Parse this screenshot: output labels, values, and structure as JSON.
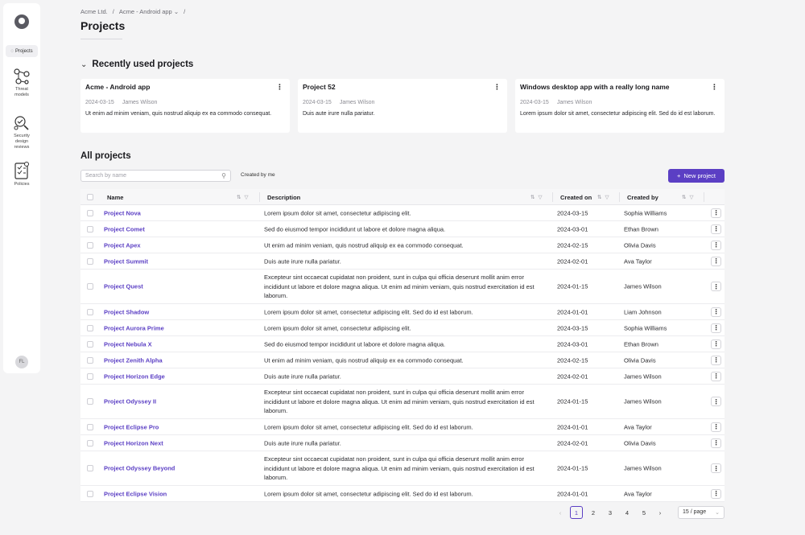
{
  "sidebar": {
    "items": [
      {
        "label": "Projects"
      },
      {
        "label_lines": [
          "Threat",
          "models"
        ]
      },
      {
        "label_lines": [
          "Security",
          "design",
          "reviews"
        ]
      },
      {
        "label_lines": [
          "Policies"
        ]
      }
    ],
    "avatar": "FL"
  },
  "breadcrumb": {
    "org": "Acme Ltd.",
    "sep1": "/",
    "project": "Acme - Android app",
    "sep2": "/"
  },
  "page_title": "Projects",
  "recent": {
    "title": "Recently used projects",
    "cards": [
      {
        "title": "Acme - Android app",
        "date": "2024-03-15",
        "user": "James Wilson",
        "desc": "Ut enim ad minim veniam, quis nostrud aliquip ex ea commodo consequat."
      },
      {
        "title": "Project 52",
        "date": "2024-03-15",
        "user": "James Wilson",
        "desc": "Duis aute irure nulla pariatur."
      },
      {
        "title": "Windows desktop app with a really long name",
        "date": "2024-03-15",
        "user": "James Wilson",
        "desc": "Lorem ipsum dolor sit amet, consectetur adipiscing elit. Sed do id est laborum."
      }
    ]
  },
  "all": {
    "title": "All projects",
    "search_placeholder": "Search by name",
    "filter_label": "Created by me",
    "new_button": "New project",
    "columns": {
      "name": "Name",
      "description": "Description",
      "created_on": "Created on",
      "created_by": "Created by"
    },
    "rows": [
      {
        "name": "Project Nova",
        "desc": "Lorem ipsum dolor sit amet, consectetur adipiscing elit.",
        "date": "2024-03-15",
        "user": "Sophia Williams"
      },
      {
        "name": "Project Comet",
        "desc": "Sed do eiusmod tempor incididunt ut labore et dolore magna aliqua.",
        "date": "2024-03-01",
        "user": "Ethan Brown"
      },
      {
        "name": "Project Apex",
        "desc": "Ut enim ad minim veniam, quis nostrud aliquip ex ea commodo consequat.",
        "date": "2024-02-15",
        "user": "Olivia Davis"
      },
      {
        "name": "Project Summit",
        "desc": "Duis aute irure nulla pariatur.",
        "date": "2024-02-01",
        "user": "Ava Taylor"
      },
      {
        "name": "Project Quest",
        "desc": "Excepteur sint occaecat cupidatat non proident, sunt in culpa qui officia deserunt mollit anim error incididunt ut labore et dolore magna aliqua. Ut enim ad minim veniam, quis nostrud exercitation id est laborum.",
        "date": "2024-01-15",
        "user": "James Wilson"
      },
      {
        "name": "Project Shadow",
        "desc": "Lorem ipsum dolor sit amet, consectetur adipiscing elit. Sed do id est laborum.",
        "date": "2024-01-01",
        "user": "Liam Johnson"
      },
      {
        "name": "Project Aurora Prime",
        "desc": "Lorem ipsum dolor sit amet, consectetur adipiscing elit.",
        "date": "2024-03-15",
        "user": "Sophia Williams"
      },
      {
        "name": "Project Nebula X",
        "desc": "Sed do eiusmod tempor incididunt ut labore et dolore magna aliqua.",
        "date": "2024-03-01",
        "user": "Ethan Brown"
      },
      {
        "name": "Project Zenith Alpha",
        "desc": "Ut enim ad minim veniam, quis nostrud aliquip ex ea commodo consequat.",
        "date": "2024-02-15",
        "user": "Olivia Davis"
      },
      {
        "name": "Project Horizon Edge",
        "desc": "Duis aute irure nulla pariatur.",
        "date": "2024-02-01",
        "user": "James Wilson"
      },
      {
        "name": "Project Odyssey II",
        "desc": "Excepteur sint occaecat cupidatat non proident, sunt in culpa qui officia deserunt mollit anim error incididunt ut labore et dolore magna aliqua. Ut enim ad minim veniam, quis nostrud exercitation id est laborum.",
        "date": "2024-01-15",
        "user": "James Wilson"
      },
      {
        "name": "Project Eclipse Pro",
        "desc": "Lorem ipsum dolor sit amet, consectetur adipiscing elit. Sed do id est laborum.",
        "date": "2024-01-01",
        "user": "Ava Taylor"
      },
      {
        "name": "Project Horizon Next",
        "desc": "Duis aute irure nulla pariatur.",
        "date": "2024-02-01",
        "user": "Olivia Davis"
      },
      {
        "name": "Project Odyssey Beyond",
        "desc": "Excepteur sint occaecat cupidatat non proident, sunt in culpa qui officia deserunt mollit anim error incididunt ut labore et dolore magna aliqua. Ut enim ad minim veniam, quis nostrud exercitation id est laborum.",
        "date": "2024-01-15",
        "user": "James Wilson"
      },
      {
        "name": "Project Eclipse Vision",
        "desc": "Lorem ipsum dolor sit amet, consectetur adipiscing elit. Sed do id est laborum.",
        "date": "2024-01-01",
        "user": "Ava Taylor"
      }
    ]
  },
  "pagination": {
    "pages": [
      "1",
      "2",
      "3",
      "4",
      "5"
    ],
    "current": "1",
    "page_size": "15 / page"
  },
  "colors": {
    "accent": "#5b3fc4"
  }
}
